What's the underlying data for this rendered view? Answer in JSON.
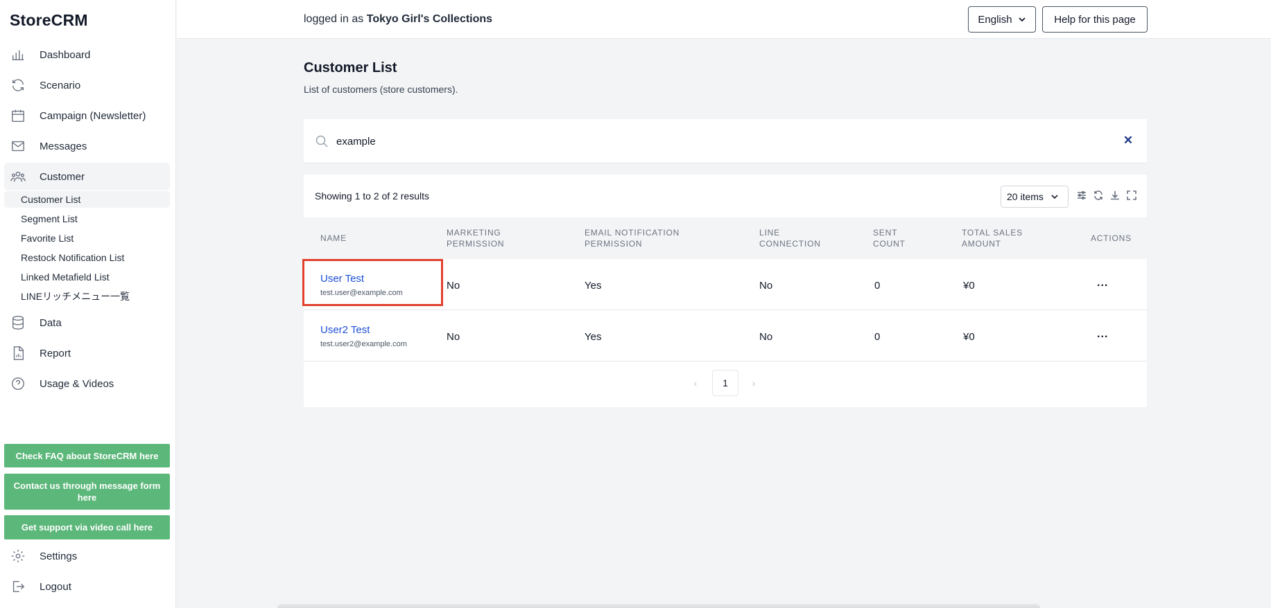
{
  "app": {
    "logo": "StoreCRM"
  },
  "sidebar": {
    "nav": [
      {
        "label": "Dashboard",
        "icon": "chart-bar-icon"
      },
      {
        "label": "Scenario",
        "icon": "refresh-icon"
      },
      {
        "label": "Campaign (Newsletter)",
        "icon": "calendar-icon"
      },
      {
        "label": "Messages",
        "icon": "envelope-icon"
      },
      {
        "label": "Customer",
        "icon": "users-icon"
      }
    ],
    "customer_sub": [
      "Customer List",
      "Segment List",
      "Favorite List",
      "Restock Notification List",
      "Linked Metafield List",
      "LINEリッチメニュー一覧"
    ],
    "nav_lower": [
      {
        "label": "Data",
        "icon": "database-icon"
      },
      {
        "label": "Report",
        "icon": "document-chart-icon"
      },
      {
        "label": "Usage & Videos",
        "icon": "question-circle-icon"
      }
    ],
    "support_buttons": [
      "Check FAQ about StoreCRM here",
      "Contact us through message form here",
      "Get support via video call here"
    ],
    "footer": [
      {
        "label": "Settings",
        "icon": "gear-icon"
      },
      {
        "label": "Logout",
        "icon": "logout-icon"
      }
    ],
    "colors": {
      "support_green": "#5cb77a"
    }
  },
  "topbar": {
    "logged_prefix": "logged in as",
    "store_name": "Tokyo Girl's Collections",
    "language": "English",
    "help": "Help for this page"
  },
  "main": {
    "title": "Customer List",
    "subtitle": "List of customers (store customers).",
    "search": {
      "value": "example"
    },
    "showing": "Showing 1 to 2 of 2 results",
    "items_per_page": "20 items",
    "columns": [
      "NAME",
      "MARKETING PERMISSION",
      "EMAIL NOTIFICATION PERMISSION",
      "LINE CONNECTION",
      "SENT COUNT",
      "TOTAL SALES AMOUNT",
      "ACTIONS"
    ],
    "rows": [
      {
        "name": "User Test",
        "email": "test.user@example.com",
        "marketing": "No",
        "email_notification": "Yes",
        "line": "No",
        "sent": "0",
        "sales": "¥0",
        "actions": "..."
      },
      {
        "name": "User2 Test",
        "email": "test.user2@example.com",
        "marketing": "No",
        "email_notification": "Yes",
        "line": "No",
        "sent": "0",
        "sales": "¥0",
        "actions": "..."
      }
    ],
    "pagination": {
      "current": "1"
    },
    "colors": {
      "link": "#1d4ed8",
      "highlight": "#e0402c"
    }
  }
}
